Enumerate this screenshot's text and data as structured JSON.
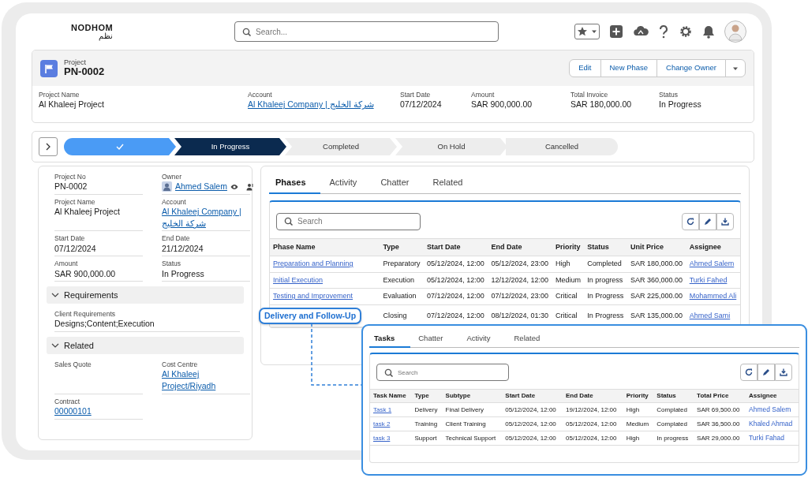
{
  "logo": {
    "latin": "NODHOM",
    "arabic": "نظم"
  },
  "search": {
    "placeholder": "Search..."
  },
  "record": {
    "object": "Project",
    "title": "PN-0002",
    "actions": [
      "Edit",
      "New Phase",
      "Change Owner"
    ],
    "fields": [
      {
        "label": "Project Name",
        "value": "Al Khaleej Project",
        "link": false
      },
      {
        "label": "Account",
        "value": "Al Khaleej Company | شركة الخليج",
        "link": true
      },
      {
        "label": "Start Date",
        "value": "07/12/2024",
        "link": false
      },
      {
        "label": "Amount",
        "value": "SAR 900,000.00",
        "link": false
      },
      {
        "label": "Total Invoice",
        "value": "SAR 180,000.00",
        "link": false
      },
      {
        "label": "Status",
        "value": "In Progress",
        "link": false
      }
    ]
  },
  "path": {
    "stages": [
      {
        "completed": true,
        "selected": false
      },
      {
        "label": "In Progress",
        "completed": false,
        "selected": true
      },
      {
        "label": "Completed",
        "completed": false,
        "selected": false
      },
      {
        "label": "On Hold",
        "completed": false,
        "selected": false
      },
      {
        "label": "Cancelled",
        "completed": false,
        "selected": false
      }
    ]
  },
  "details": {
    "fields": [
      {
        "label": "Project No",
        "value": "PN-0002",
        "link": false
      },
      {
        "label": "Owner",
        "value": "Ahmed Salem",
        "link": true,
        "kind": "user"
      },
      {
        "label": "Project Name",
        "value": "Al Khaleej Project",
        "link": false
      },
      {
        "label": "Account",
        "value": "Al Khaleej Company | شركة الخليج",
        "link": true
      },
      {
        "label": "Start Date",
        "value": "07/12/2024",
        "link": false
      },
      {
        "label": "End Date",
        "value": "21/12/2024",
        "link": false
      },
      {
        "label": "Amount",
        "value": "SAR 900,000.00",
        "link": false
      },
      {
        "label": "Status",
        "value": "In Progress",
        "link": false
      }
    ],
    "sections": [
      {
        "title": "Requirements",
        "expanded": true,
        "fields": [
          {
            "label": "Client Requirements",
            "value": "Designs;Content;Execution",
            "link": false
          }
        ]
      },
      {
        "title": "Related",
        "expanded": true,
        "fields": [
          {
            "label": "Sales Quote"
          },
          {
            "label": "Cost Centre",
            "value": "Al Khaleej Project/Riyadh",
            "link": true
          },
          {
            "label": "Contract",
            "value": "00000101",
            "link": true
          }
        ]
      }
    ]
  },
  "phases": {
    "tabs": [
      {
        "label": "Phases",
        "selected": true
      },
      {
        "label": "Activity",
        "selected": false
      },
      {
        "label": "Chatter",
        "selected": false
      },
      {
        "label": "Related",
        "selected": false
      }
    ],
    "search": {
      "placeholder": "Search"
    },
    "columns": [
      "Phase Name",
      "Type",
      "Start Date",
      "End Date",
      "Priority",
      "Status",
      "Unit Price",
      "Assignee"
    ],
    "rows": [
      {
        "highlighted": false,
        "cells": [
          "Preparation and Planning",
          "Preparatory",
          "05/12/2024, 12:00",
          "05/12/2024, 23:00",
          "High",
          "Completed",
          "SAR 180,000.00",
          "Ahmed Salem"
        ]
      },
      {
        "highlighted": false,
        "cells": [
          "Initial Execution",
          "Execution",
          "05/12/2024, 12:00",
          "12/12/2024, 12:00",
          "Medium",
          "In progress",
          "SAR 360,000.00",
          "Turki Fahed"
        ]
      },
      {
        "highlighted": false,
        "cells": [
          "Testing and Improvement",
          "Evaluation",
          "07/12/2024, 12:00",
          "07/12/2024, 23:00",
          "Critical",
          "In Progress",
          "SAR 225,000.00",
          "Mohammed Ali"
        ]
      },
      {
        "highlighted": true,
        "cells": [
          "Delivery and Follow-Up",
          "Closing",
          "07/12/2024, 12:00",
          "08/12/2024, 01:30",
          "Critical",
          "In Progress",
          "SAR 135,000.00",
          "Ahmed Sami"
        ]
      }
    ]
  },
  "tasks": {
    "tabs": [
      {
        "label": "Tasks",
        "selected": true
      },
      {
        "label": "Chatter",
        "selected": false
      },
      {
        "label": "Activity",
        "selected": false
      },
      {
        "label": "Related",
        "selected": false
      }
    ],
    "search": {
      "placeholder": "Search"
    },
    "columns": [
      "Task Name",
      "Type",
      "Subtype",
      "Start Date",
      "End Date",
      "Priority",
      "Status",
      "Total Price",
      "Assignee"
    ],
    "rows": [
      {
        "cells": [
          "Task 1",
          "Delivery",
          "Final Delivery",
          "05/12/2024, 12:00",
          "19/12/2024, 12:00",
          "High",
          "Complated",
          "SAR 69,500.00",
          "Ahmed Salem"
        ]
      },
      {
        "cells": [
          "task 2",
          "Training",
          "Client Training",
          "05/12/2024, 12:00",
          "05/12/2024, 12:00",
          "Medium",
          "Complated",
          "SAR 36,500.00",
          "Khaled Ahmad"
        ]
      },
      {
        "cells": [
          "task 3",
          "Support",
          "Technical Support",
          "05/12/2024, 12:00",
          "05/12/2024, 12:00",
          "High",
          "In progress",
          "SAR 29,000.00",
          "Turki Fahad"
        ]
      }
    ]
  }
}
